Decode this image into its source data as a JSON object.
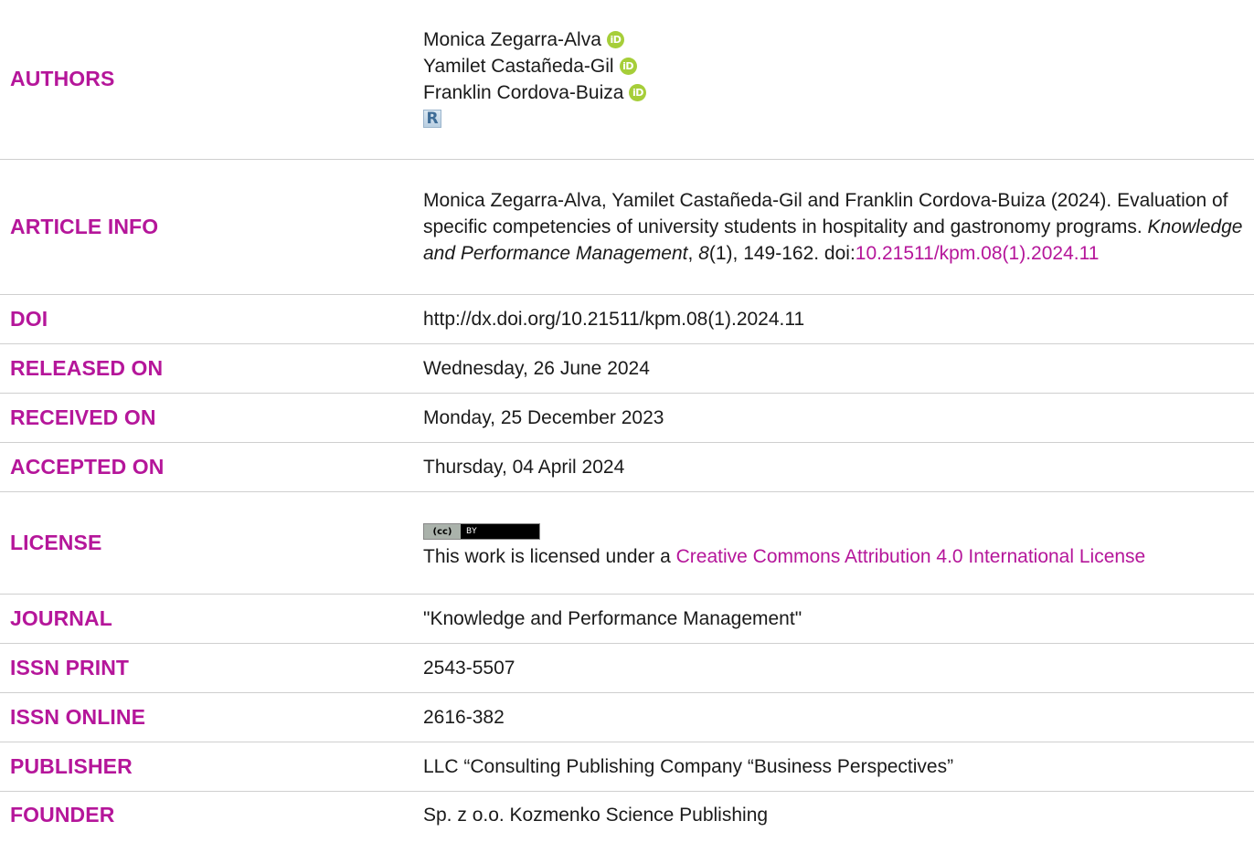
{
  "labels": {
    "authors": "AUTHORS",
    "article_info": "ARTICLE INFO",
    "doi": "DOI",
    "released_on": "RELEASED ON",
    "received_on": "RECEIVED ON",
    "accepted_on": "ACCEPTED ON",
    "license": "LICENSE",
    "journal": "JOURNAL",
    "issn_print": "ISSN PRINT",
    "issn_online": "ISSN ONLINE",
    "publisher": "PUBLISHER",
    "founder": "FOUNDER"
  },
  "authors": [
    {
      "name": "Monica Zegarra-Alva",
      "orcid_icon": "orcid-icon"
    },
    {
      "name": "Yamilet Castañeda-Gil",
      "orcid_icon": "orcid-icon"
    },
    {
      "name": "Franklin Cordova-Buiza",
      "orcid_icon": "orcid-icon"
    }
  ],
  "icons": {
    "orcid_text": "iD",
    "researcherid_text": "R",
    "cc_left": "(cc)",
    "cc_right": "BY"
  },
  "article_info": {
    "citation_start": "Monica Zegarra-Alva, Yamilet Castañeda-Gil and Franklin Cordova-Buiza (2024). Evaluation of specific competencies of university students in hospitality and gastronomy programs. ",
    "journal_italic": "Knowledge and Performance Management",
    "comma1": ", ",
    "volume_italic": "8",
    "issue_pages": "(1), 149-162. doi:",
    "doi_link": "10.21511/kpm.08(1).2024.11"
  },
  "values": {
    "doi": "http://dx.doi.org/10.21511/kpm.08(1).2024.11",
    "released_on": "Wednesday, 26 June 2024",
    "received_on": "Monday, 25 December 2023",
    "accepted_on": "Thursday, 04 April 2024",
    "journal": "\"Knowledge and Performance Management\"",
    "issn_print": "2543-5507",
    "issn_online": "2616-382",
    "publisher": "LLC “Consulting Publishing Company “Business Perspectives”",
    "founder": "Sp. z o.o. Kozmenko Science Publishing"
  },
  "license": {
    "text_start": "This work is licensed under a ",
    "link_text": "Creative Commons Attribution 4.0 International License"
  },
  "colors": {
    "label": "#b5169a",
    "link": "#b5169a",
    "orcid": "#a6ce39",
    "text": "#1a1a1a"
  }
}
